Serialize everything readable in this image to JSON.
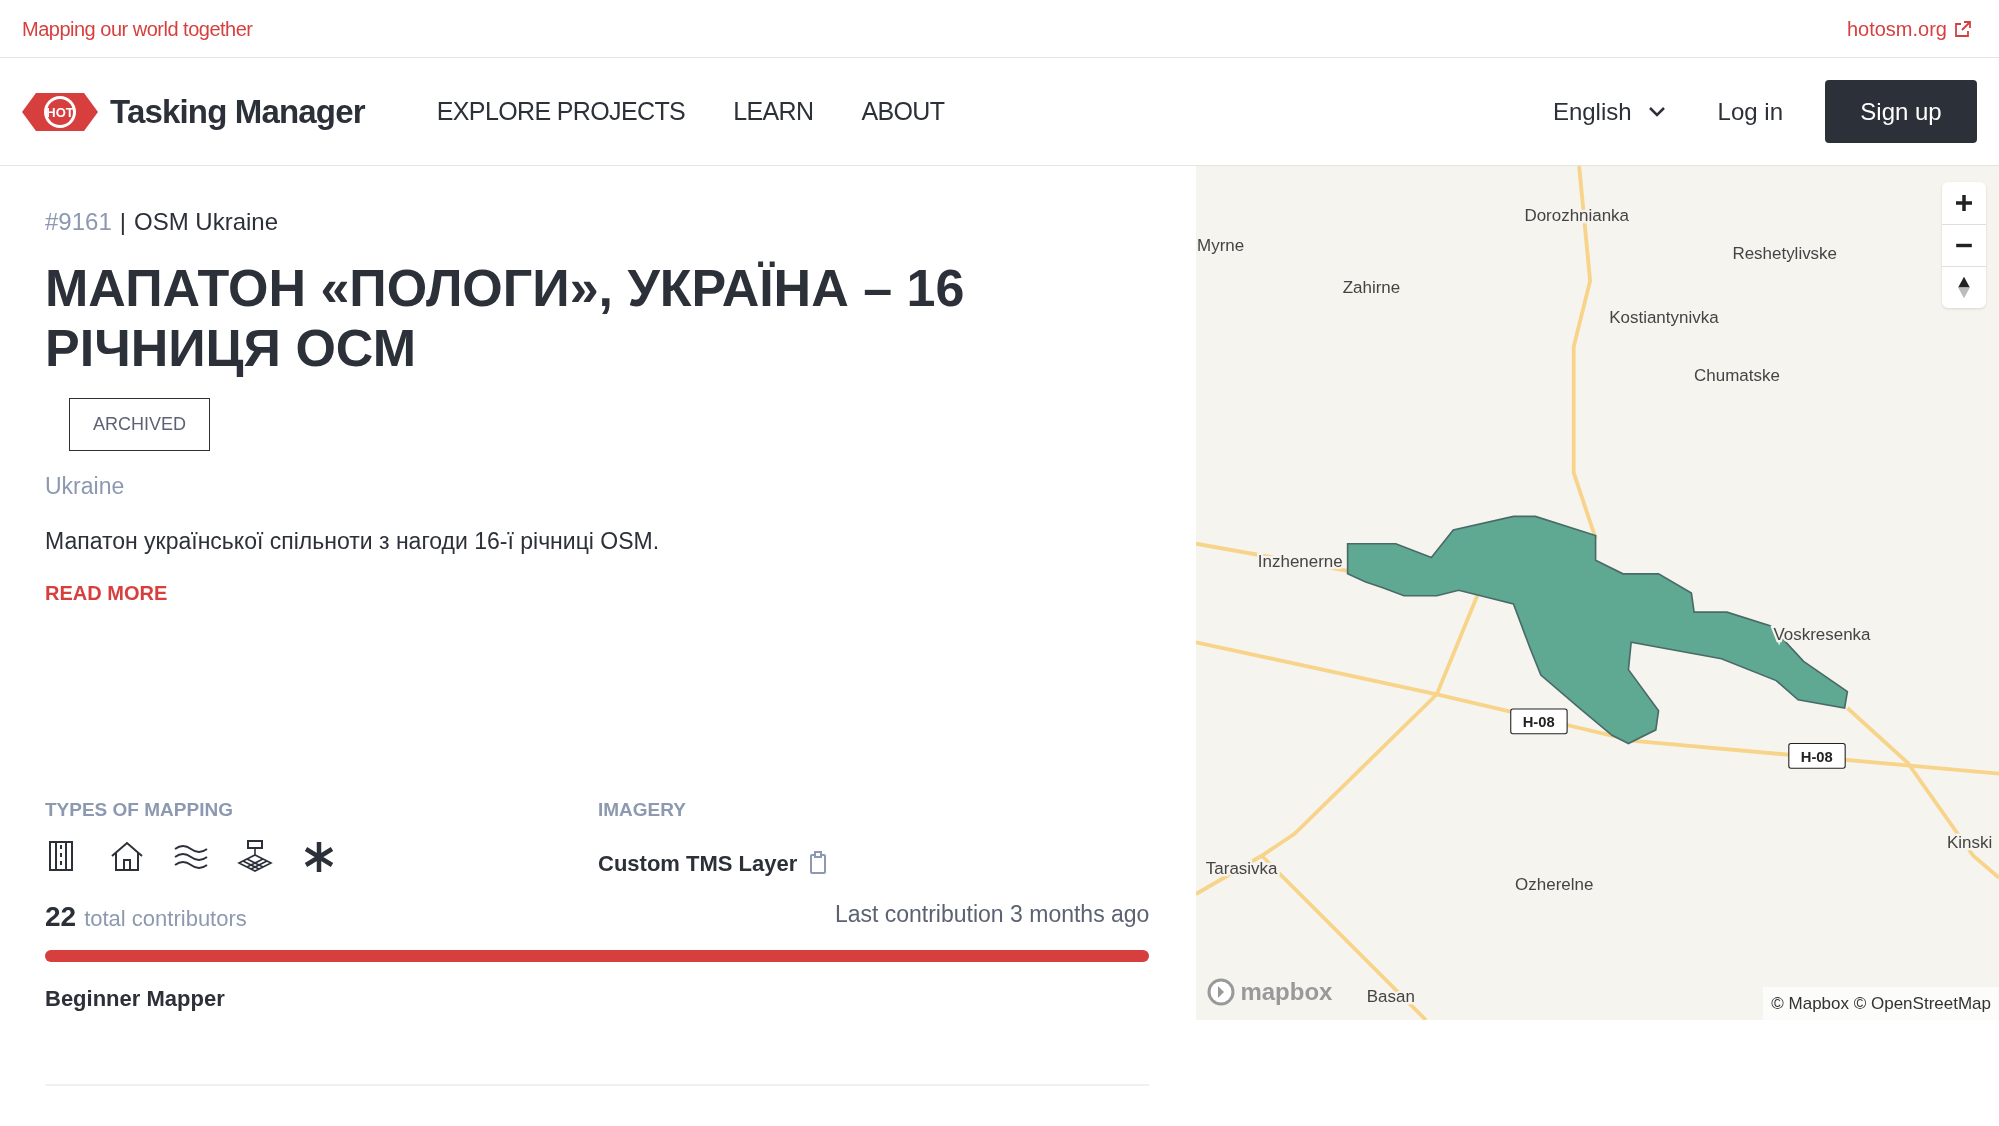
{
  "top_bar": {
    "tagline": "Mapping our world together",
    "link": "hotosm.org"
  },
  "nav": {
    "logo_badge": "HOT",
    "logo_text": "Tasking Manager",
    "links": [
      "EXPLORE PROJECTS",
      "LEARN",
      "ABOUT"
    ],
    "language": "English",
    "login": "Log in",
    "signup": "Sign up"
  },
  "project": {
    "id": "#9161",
    "separator": "|",
    "organisation": "OSM Ukraine",
    "title": "МАПАТОН «ПОЛОГИ», УКРАЇНА – 16 РІЧНИЦЯ ОСМ",
    "status": "ARCHIVED",
    "country": "Ukraine",
    "description": "Мапатон української спільноти з нагоди 16-ї річниці OSM.",
    "read_more": "READ MORE"
  },
  "mapping": {
    "heading": "TYPES OF MAPPING",
    "types": [
      {
        "kind": "roads"
      },
      {
        "kind": "buildings"
      },
      {
        "kind": "waterways"
      },
      {
        "kind": "land_use"
      },
      {
        "kind": "other"
      }
    ]
  },
  "imagery": {
    "heading": "IMAGERY",
    "value": "Custom TMS Layer"
  },
  "contributors": {
    "count": "22",
    "label": "total contributors",
    "last": "Last contribution 3 months ago",
    "level": 1
  },
  "difficulty": "Beginner Mapper",
  "map": {
    "labels": [
      "Dorozhnianka",
      "Myrne",
      "Zahirne",
      "Reshetylivske",
      "Kostiantynivka",
      "Chumatske",
      "Inzhenerne",
      "Voskresenka",
      "Kinski",
      "Tarasivka",
      "Ozherelne",
      "Basan"
    ],
    "shields": [
      "H-08",
      "H-08"
    ],
    "logo": "mapbox",
    "attribution": "© Mapbox © OpenStreetMap"
  }
}
